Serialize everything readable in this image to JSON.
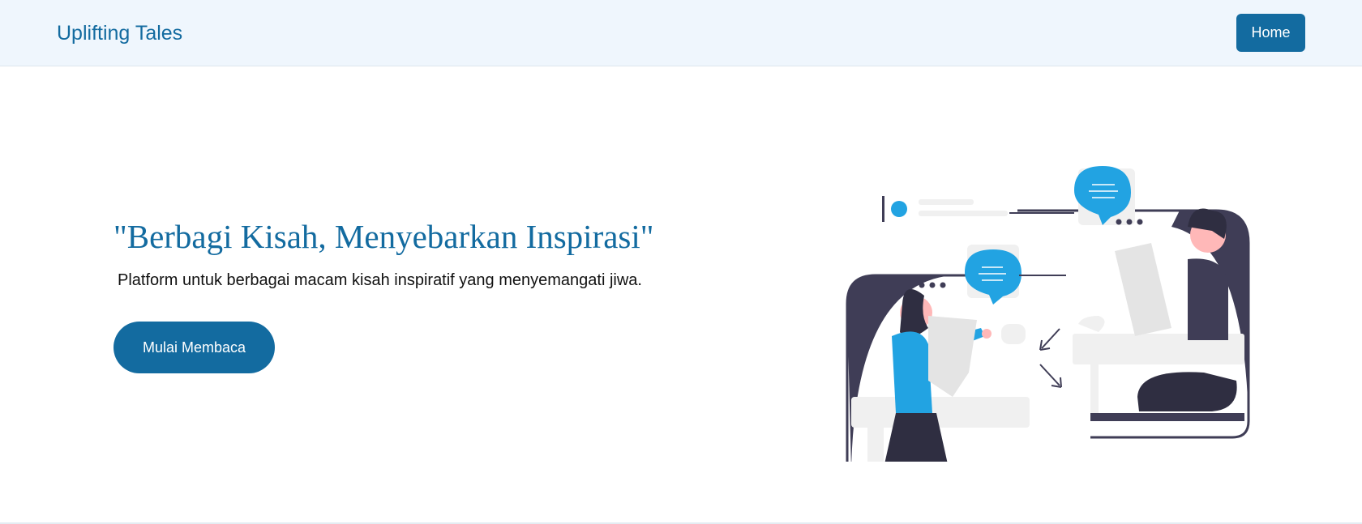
{
  "nav": {
    "brand": "Uplifting Tales",
    "home_label": "Home"
  },
  "hero": {
    "title": "\"Berbagi Kisah, Menyebarkan Inspirasi\"",
    "subtitle": "Platform untuk berbagai macam kisah inspiratif yang menyemangati jiwa.",
    "cta_label": "Mulai Membaca"
  },
  "colors": {
    "brand": "#136ba0",
    "nav_bg": "#eff6fd",
    "accent_blue": "#22a3e2",
    "dark": "#3f3d56",
    "light_gray": "#f0f0f0"
  },
  "icons": [
    "speech-bubble-icon",
    "arrow-icon"
  ]
}
